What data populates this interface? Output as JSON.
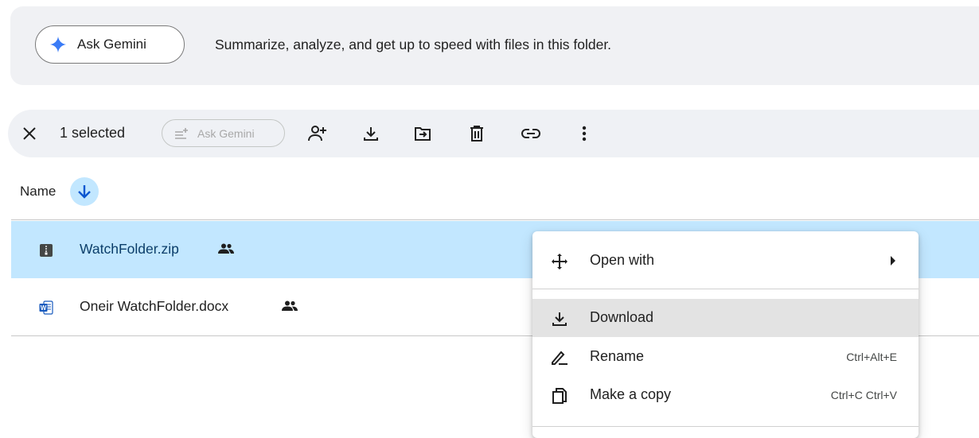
{
  "banner": {
    "button_label": "Ask Gemini",
    "text": "Summarize, analyze, and get up to speed with files in this folder.",
    "accent": "#1a73e8"
  },
  "toolbar": {
    "selected_count": "1 selected",
    "ask_gemini_label": "Ask Gemini",
    "icons": [
      "close-icon",
      "ask-gemini-icon",
      "share-icon",
      "download-icon",
      "move-icon",
      "trash-icon",
      "link-icon",
      "more-vert-icon"
    ]
  },
  "list": {
    "name_header": "Name",
    "sort": "descending",
    "files": [
      {
        "name": "WatchFolder.zip",
        "type": "zip",
        "shared": true,
        "selected": true
      },
      {
        "name": "Oneir WatchFolder.docx",
        "type": "docx",
        "shared": true,
        "selected": false
      }
    ]
  },
  "context_menu": {
    "items": [
      {
        "label": "Open with",
        "icon": "open-with-icon",
        "shortcut": "",
        "submenu": true
      },
      {
        "label": "Download",
        "icon": "download-icon",
        "shortcut": "",
        "highlighted": true
      },
      {
        "label": "Rename",
        "icon": "rename-pencil-icon",
        "shortcut": "Ctrl+Alt+E"
      },
      {
        "label": "Make a copy",
        "icon": "copy-icon",
        "shortcut": "Ctrl+C Ctrl+V"
      }
    ]
  },
  "colors": {
    "selected_row": "#c2e7ff",
    "sort_button": "#c2e7ff",
    "banner_bg": "#f0f1f4",
    "toolbar_bg": "#eff1f5",
    "menu_highlight": "#e3e3e3",
    "word_blue": "#185abd"
  }
}
